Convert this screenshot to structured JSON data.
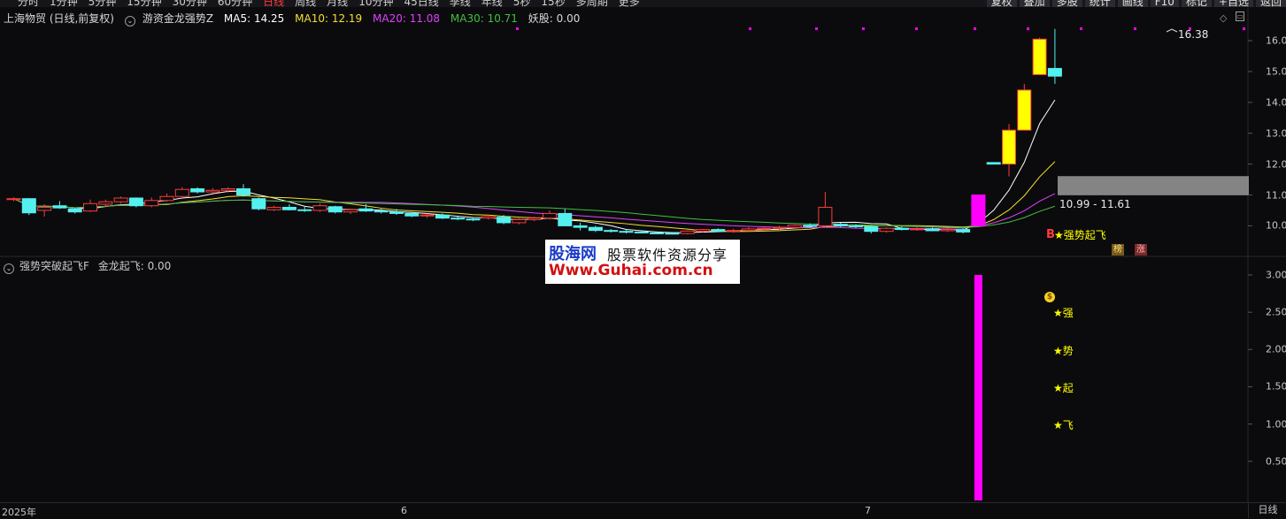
{
  "toolbar": {
    "periods": [
      "分时",
      "1分钟",
      "5分钟",
      "15分钟",
      "30分钟",
      "60分钟",
      "日线",
      "周线",
      "月线",
      "10分钟",
      "45日线",
      "季线",
      "年线",
      "5秒",
      "15秒",
      "多周期",
      "更多"
    ],
    "active_period": "日线",
    "tools": [
      "复权",
      "叠加",
      "多股",
      "统计",
      "画线",
      "F10",
      "标记",
      "+自选",
      "返回"
    ]
  },
  "main_panel": {
    "stock": "上海物贸 (日线,前复权)",
    "indicator_name": "游资金龙强势Z",
    "ma5_label": "MA5: 14.25",
    "ma10_label": "MA10: 12.19",
    "ma20_label": "MA20: 11.08",
    "ma30_label": "MA30: 10.71",
    "yao_label": "妖股: 0.00",
    "price_ticks": [
      "16.00",
      "15.00",
      "14.00",
      "13.00",
      "12.00",
      "11.00",
      "10.00"
    ],
    "high_label": "16.38",
    "range_label": "10.99 - 11.61",
    "signal_label": "★强势起飞",
    "buy_marker": "B",
    "badge_1": "榜",
    "badge_2": "涨"
  },
  "sub_panel": {
    "indicator_name": "强势突破起飞F",
    "value_label": "金龙起飞: 0.00",
    "ticks": [
      "3.00",
      "2.50",
      "2.00",
      "1.50",
      "1.00",
      "0.50"
    ],
    "stars": [
      "★强",
      "★势",
      "★起",
      "★飞"
    ],
    "coin_icon": "money-bag-icon"
  },
  "date_axis": {
    "labels": [
      "2025年",
      "6",
      "7"
    ],
    "period_label": "日线"
  },
  "watermark": {
    "line1": "股海网",
    "line2": "股票软件资源分享",
    "line3": "Www.Guhai.com.cn"
  },
  "colors": {
    "up": "#ff3b3b",
    "down": "#54f0f0",
    "ma5": "#ffffff",
    "ma10": "#f0e030",
    "ma20": "#e040ff",
    "ma30": "#40c040",
    "signal_bar": "#ff00ff",
    "gain_box": "#ffff00"
  },
  "chart_data": {
    "type": "candlestick",
    "ohlc": [
      [
        10.85,
        10.92,
        10.8,
        10.88
      ],
      [
        10.88,
        10.9,
        10.35,
        10.42
      ],
      [
        10.5,
        10.7,
        10.3,
        10.6
      ],
      [
        10.65,
        10.8,
        10.55,
        10.58
      ],
      [
        10.55,
        10.58,
        10.4,
        10.45
      ],
      [
        10.48,
        10.85,
        10.45,
        10.72
      ],
      [
        10.7,
        10.85,
        10.6,
        10.78
      ],
      [
        10.78,
        10.95,
        10.72,
        10.9
      ],
      [
        10.9,
        10.92,
        10.6,
        10.65
      ],
      [
        10.65,
        10.92,
        10.6,
        10.82
      ],
      [
        10.82,
        11.05,
        10.78,
        10.95
      ],
      [
        10.95,
        11.25,
        10.9,
        11.18
      ],
      [
        11.2,
        11.25,
        11.05,
        11.1
      ],
      [
        11.1,
        11.22,
        11.05,
        11.15
      ],
      [
        11.15,
        11.25,
        11.08,
        11.2
      ],
      [
        11.2,
        11.35,
        10.95,
        11.0
      ],
      [
        10.88,
        10.92,
        10.5,
        10.55
      ],
      [
        10.52,
        10.65,
        10.48,
        10.6
      ],
      [
        10.6,
        10.7,
        10.5,
        10.52
      ],
      [
        10.52,
        10.62,
        10.45,
        10.5
      ],
      [
        10.5,
        10.72,
        10.45,
        10.65
      ],
      [
        10.62,
        10.65,
        10.4,
        10.45
      ],
      [
        10.45,
        10.55,
        10.38,
        10.52
      ],
      [
        10.55,
        10.7,
        10.45,
        10.48
      ],
      [
        10.48,
        10.55,
        10.4,
        10.45
      ],
      [
        10.45,
        10.55,
        10.35,
        10.4
      ],
      [
        10.4,
        10.45,
        10.28,
        10.32
      ],
      [
        10.32,
        10.4,
        10.25,
        10.35
      ],
      [
        10.35,
        10.4,
        10.22,
        10.25
      ],
      [
        10.25,
        10.3,
        10.18,
        10.22
      ],
      [
        10.22,
        10.28,
        10.15,
        10.2
      ],
      [
        10.25,
        10.35,
        10.2,
        10.3
      ],
      [
        10.28,
        10.35,
        10.05,
        10.1
      ],
      [
        10.1,
        10.25,
        10.05,
        10.2
      ],
      [
        10.2,
        10.3,
        10.15,
        10.25
      ],
      [
        10.25,
        10.5,
        10.2,
        10.4
      ],
      [
        10.4,
        10.55,
        10.15,
        10.0
      ],
      [
        10.0,
        10.1,
        9.85,
        9.95
      ],
      [
        9.95,
        10.0,
        9.8,
        9.85
      ],
      [
        9.85,
        9.9,
        9.78,
        9.82
      ],
      [
        9.82,
        9.88,
        9.75,
        9.8
      ],
      [
        9.8,
        9.85,
        9.75,
        9.77
      ],
      [
        9.77,
        9.82,
        9.73,
        9.76
      ],
      [
        9.76,
        9.8,
        9.72,
        9.75
      ],
      [
        9.75,
        9.85,
        9.72,
        9.83
      ],
      [
        9.83,
        9.9,
        9.78,
        9.88
      ],
      [
        9.88,
        9.92,
        9.8,
        9.83
      ],
      [
        9.83,
        9.9,
        9.78,
        9.85
      ],
      [
        9.85,
        9.95,
        9.82,
        9.9
      ],
      [
        9.9,
        9.95,
        9.85,
        9.92
      ],
      [
        9.92,
        10.0,
        9.88,
        9.95
      ],
      [
        9.95,
        10.05,
        9.9,
        10.02
      ],
      [
        10.02,
        10.08,
        9.95,
        9.98
      ],
      [
        10.0,
        11.1,
        9.95,
        10.6
      ],
      [
        10.05,
        10.1,
        9.95,
        10.0
      ],
      [
        10.0,
        10.05,
        9.93,
        9.97
      ],
      [
        9.97,
        10.02,
        9.75,
        9.82
      ],
      [
        9.82,
        9.95,
        9.78,
        9.92
      ],
      [
        9.92,
        9.98,
        9.85,
        9.88
      ],
      [
        9.88,
        9.95,
        9.84,
        9.9
      ],
      [
        9.9,
        9.95,
        9.82,
        9.84
      ],
      [
        9.84,
        9.92,
        9.8,
        9.88
      ],
      [
        9.88,
        9.92,
        9.75,
        9.8
      ],
      [
        10.0,
        11.0,
        9.95,
        11.0
      ],
      [
        12.05,
        12.05,
        12.0,
        12.0
      ],
      [
        12.0,
        13.3,
        11.6,
        13.1
      ],
      [
        13.1,
        14.6,
        13.3,
        14.4
      ],
      [
        14.9,
        16.1,
        14.9,
        16.05
      ],
      [
        15.1,
        16.38,
        14.6,
        14.85
      ]
    ],
    "signal_days": [
      63
    ],
    "price_range": [
      9.7,
      16.6
    ],
    "sub_range": [
      0,
      3.1
    ],
    "sub_bar_value": 3.0
  }
}
